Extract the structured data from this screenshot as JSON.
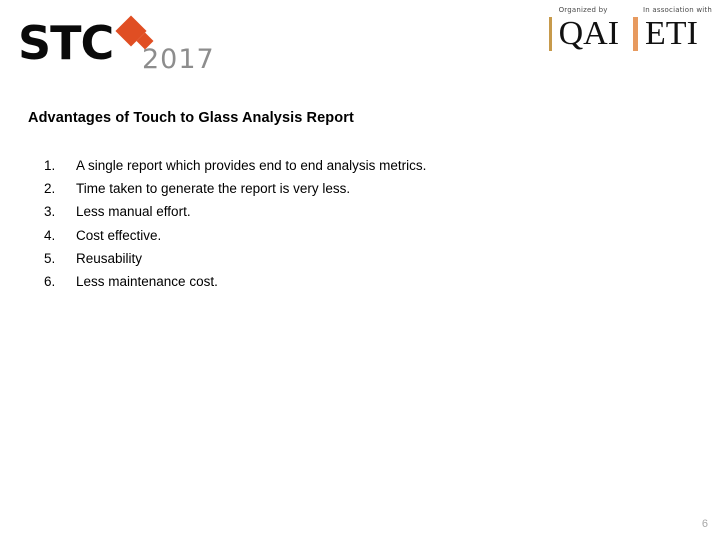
{
  "header": {
    "brand": {
      "name": "STC",
      "year": "2017",
      "diamond_color": "#E04E23",
      "year_color": "#8D8D8D"
    },
    "partners": [
      {
        "caption": "Organized by",
        "name": "QAI",
        "bar_color": "#C79A4B"
      },
      {
        "caption": "In association with",
        "name": "ETI",
        "bar_color": "#E79A5F"
      }
    ]
  },
  "slide": {
    "title": "Advantages of Touch to Glass Analysis Report",
    "items": [
      {
        "number": "1.",
        "text": "A single report which provides end to end analysis metrics."
      },
      {
        "number": "2.",
        "text": "Time taken to generate the report is very less."
      },
      {
        "number": "3.",
        "text": "Less manual effort."
      },
      {
        "number": "4.",
        "text": "Cost effective."
      },
      {
        "number": "5.",
        "text": "Reusability"
      },
      {
        "number": "6.",
        "text": "Less maintenance cost."
      }
    ],
    "page_number": "6"
  }
}
